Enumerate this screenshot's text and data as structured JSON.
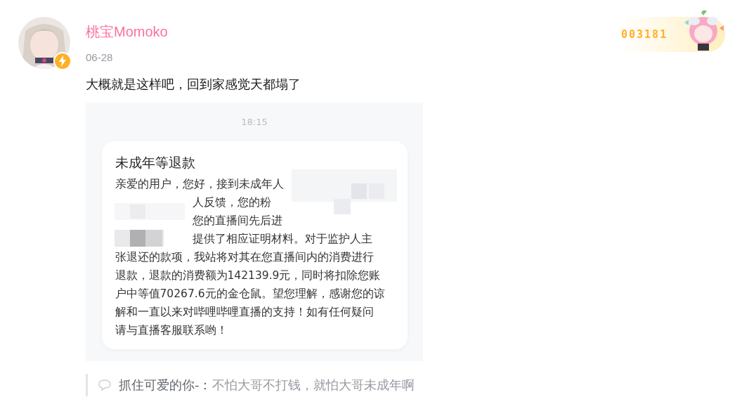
{
  "post": {
    "author": "桃宝Momoko",
    "date": "06-28",
    "text": "大概就是这样吧，回到家感觉天都塌了",
    "badge": {
      "number": "003181"
    },
    "image": {
      "time": "18:15",
      "title": "未成年等退款",
      "lines": [
        {
          "text": "亲爱的用户，您好，接到未成年人",
          "indent": false
        },
        {
          "text": "人反馈，您的粉",
          "indent": true
        },
        {
          "text": "您的直播间先后进",
          "indent": true
        },
        {
          "text": "提供了相应证明材料。对于监护人主",
          "indent": true
        },
        {
          "text": "张退还的款项，我站将对其在您直播间内的消费进行",
          "indent": false
        },
        {
          "text": "退款，退款的消费额为142139.9元，同时将扣除您账",
          "indent": false
        },
        {
          "text": "户中等值70267.6元的金仓鼠。望您理解，感谢您的谅",
          "indent": false
        },
        {
          "text": "解和一直以来对哔哩哔哩直播的支持！如有任何疑问",
          "indent": false
        },
        {
          "text": "请与直播客服联系哟！",
          "indent": false
        }
      ]
    }
  },
  "comment": {
    "user": "抓住可爱的你-：",
    "text": "不怕大哥不打钱，就怕大哥未成年啊"
  }
}
